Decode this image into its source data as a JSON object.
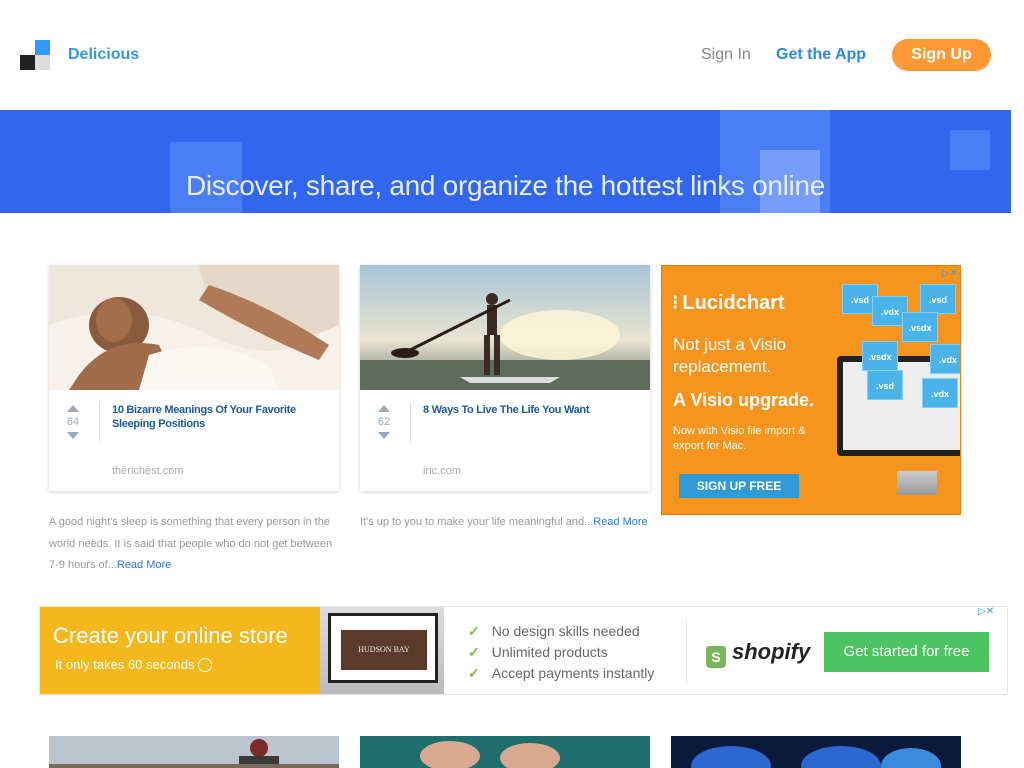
{
  "header": {
    "brand": "Delicious",
    "sign_in": "Sign In",
    "get_app": "Get the App",
    "sign_up": "Sign Up"
  },
  "hero": {
    "headline": "Discover, share, and organize the hottest links online"
  },
  "cards": [
    {
      "votes": "64",
      "title": "10 Bizarre Meanings Of Your Favorite Sleeping Positions",
      "source": "therichest.com",
      "description": "A good night's sleep is something that every person in the world needs. It is said that people who do not get between 7-9 hours of...",
      "read_more": "Read More"
    },
    {
      "votes": "62",
      "title": "8 Ways To Live The Life You Want",
      "source": "inc.com",
      "description": "It's up to you to make your life meaningful and...",
      "read_more": "Read More"
    }
  ],
  "ad_lucid": {
    "brand": "Lucidchart",
    "line1": "Not just a Visio replacement.",
    "line2": "A Visio upgrade.",
    "line3": "Now with Visio file import & export for Mac.",
    "cta": "SIGN UP FREE",
    "files": [
      ".vsd",
      ".vdx",
      ".vsd",
      ".vsdx",
      ".vsdx",
      ".vdx",
      ".vsd",
      ".vdx"
    ]
  },
  "ad_shopify": {
    "headline": "Create your online store",
    "sub": "It only takes 60 seconds",
    "screen_text": "HUDSON BAY",
    "checks": [
      "No design skills needed",
      "Unlimited products",
      "Accept payments instantly"
    ],
    "brand": "shopify",
    "cta": "Get started for free"
  },
  "colors": {
    "accent_blue": "#2a8ae6",
    "sign_up_orange": "#ff9933",
    "hero_blue": "#3366ee"
  }
}
